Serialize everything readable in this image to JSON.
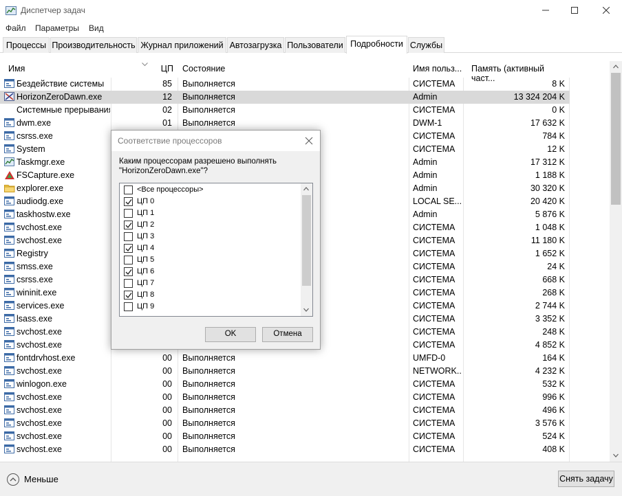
{
  "window": {
    "title": "Диспетчер задач"
  },
  "menu": [
    "Файл",
    "Параметры",
    "Вид"
  ],
  "tabs": [
    "Процессы",
    "Производительность",
    "Журнал приложений",
    "Автозагрузка",
    "Пользователи",
    "Подробности",
    "Службы"
  ],
  "active_tab": "Подробности",
  "table": {
    "columns": [
      "Имя",
      "ЦП",
      "Состояние",
      "Имя польз...",
      "Память (активный част..."
    ],
    "rows": [
      {
        "icon": "system-idle-icon",
        "name": "Бездействие системы",
        "cpu": "85",
        "state": "Выполняется",
        "user": "СИСТЕМА",
        "mem": "8 K"
      },
      {
        "icon": "game-icon",
        "name": "HorizonZeroDawn.exe",
        "cpu": "12",
        "state": "Выполняется",
        "user": "Admin",
        "mem": "13 324 204 K",
        "selected": true
      },
      {
        "icon": "none",
        "name": "Системные прерывания",
        "cpu": "02",
        "state": "Выполняется",
        "user": "СИСТЕМА",
        "mem": "0 K"
      },
      {
        "icon": "process-icon",
        "name": "dwm.exe",
        "cpu": "01",
        "state": "Выполняется",
        "user": "DWM-1",
        "mem": "17 632 K"
      },
      {
        "icon": "process-icon",
        "name": "csrss.exe",
        "cpu": "",
        "state": "",
        "user": "СИСТЕМА",
        "mem": "784 K"
      },
      {
        "icon": "process-icon",
        "name": "System",
        "cpu": "",
        "state": "",
        "user": "СИСТЕМА",
        "mem": "12 K"
      },
      {
        "icon": "taskmgr-icon",
        "name": "Taskmgr.exe",
        "cpu": "",
        "state": "",
        "user": "Admin",
        "mem": "17 312 K"
      },
      {
        "icon": "fscapture-icon",
        "name": "FSCapture.exe",
        "cpu": "",
        "state": "",
        "user": "Admin",
        "mem": "1 188 K"
      },
      {
        "icon": "explorer-icon",
        "name": "explorer.exe",
        "cpu": "",
        "state": "",
        "user": "Admin",
        "mem": "30 320 K"
      },
      {
        "icon": "process-icon",
        "name": "audiodg.exe",
        "cpu": "",
        "state": "",
        "user": "LOCAL SE...",
        "mem": "20 420 K"
      },
      {
        "icon": "process-icon",
        "name": "taskhostw.exe",
        "cpu": "",
        "state": "",
        "user": "Admin",
        "mem": "5 876 K"
      },
      {
        "icon": "process-icon",
        "name": "svchost.exe",
        "cpu": "",
        "state": "",
        "user": "СИСТЕМА",
        "mem": "1 048 K"
      },
      {
        "icon": "process-icon",
        "name": "svchost.exe",
        "cpu": "",
        "state": "",
        "user": "СИСТЕМА",
        "mem": "11 180 K"
      },
      {
        "icon": "process-icon",
        "name": "Registry",
        "cpu": "",
        "state": "",
        "user": "СИСТЕМА",
        "mem": "1 652 K"
      },
      {
        "icon": "process-icon",
        "name": "smss.exe",
        "cpu": "",
        "state": "",
        "user": "СИСТЕМА",
        "mem": "24 K"
      },
      {
        "icon": "process-icon",
        "name": "csrss.exe",
        "cpu": "",
        "state": "",
        "user": "СИСТЕМА",
        "mem": "668 K"
      },
      {
        "icon": "process-icon",
        "name": "wininit.exe",
        "cpu": "",
        "state": "",
        "user": "СИСТЕМА",
        "mem": "268 K"
      },
      {
        "icon": "process-icon",
        "name": "services.exe",
        "cpu": "",
        "state": "",
        "user": "СИСТЕМА",
        "mem": "2 744 K"
      },
      {
        "icon": "process-icon",
        "name": "lsass.exe",
        "cpu": "",
        "state": "",
        "user": "СИСТЕМА",
        "mem": "3 352 K"
      },
      {
        "icon": "process-icon",
        "name": "svchost.exe",
        "cpu": "",
        "state": "",
        "user": "СИСТЕМА",
        "mem": "248 K"
      },
      {
        "icon": "process-icon",
        "name": "svchost.exe",
        "cpu": "",
        "state": "",
        "user": "СИСТЕМА",
        "mem": "4 852 K"
      },
      {
        "icon": "process-icon",
        "name": "fontdrvhost.exe",
        "cpu": "00",
        "state": "Выполняется",
        "user": "UMFD-0",
        "mem": "164 K"
      },
      {
        "icon": "process-icon",
        "name": "svchost.exe",
        "cpu": "00",
        "state": "Выполняется",
        "user": "NETWORK...",
        "mem": "4 232 K"
      },
      {
        "icon": "process-icon",
        "name": "winlogon.exe",
        "cpu": "00",
        "state": "Выполняется",
        "user": "СИСТЕМА",
        "mem": "532 K"
      },
      {
        "icon": "process-icon",
        "name": "svchost.exe",
        "cpu": "00",
        "state": "Выполняется",
        "user": "СИСТЕМА",
        "mem": "996 K"
      },
      {
        "icon": "process-icon",
        "name": "svchost.exe",
        "cpu": "00",
        "state": "Выполняется",
        "user": "СИСТЕМА",
        "mem": "496 K"
      },
      {
        "icon": "process-icon",
        "name": "svchost.exe",
        "cpu": "00",
        "state": "Выполняется",
        "user": "СИСТЕМА",
        "mem": "3 576 K"
      },
      {
        "icon": "process-icon",
        "name": "svchost.exe",
        "cpu": "00",
        "state": "Выполняется",
        "user": "СИСТЕМА",
        "mem": "524 K"
      },
      {
        "icon": "process-icon",
        "name": "svchost.exe",
        "cpu": "00",
        "state": "Выполняется",
        "user": "СИСТЕМА",
        "mem": "408 K"
      }
    ]
  },
  "footer": {
    "less_label": "Меньше",
    "end_task_label": "Снять задачу"
  },
  "dialog": {
    "title": "Соответствие процессоров",
    "prompt_line1": "Каким процессорам разрешено выполнять",
    "prompt_line2": "\"HorizonZeroDawn.exe\"?",
    "items": [
      {
        "label": "<Все процессоры>",
        "checked": false
      },
      {
        "label": "ЦП 0",
        "checked": true
      },
      {
        "label": "ЦП 1",
        "checked": false
      },
      {
        "label": "ЦП 2",
        "checked": true
      },
      {
        "label": "ЦП 3",
        "checked": false
      },
      {
        "label": "ЦП 4",
        "checked": true
      },
      {
        "label": "ЦП 5",
        "checked": false
      },
      {
        "label": "ЦП 6",
        "checked": true
      },
      {
        "label": "ЦП 7",
        "checked": false
      },
      {
        "label": "ЦП 8",
        "checked": true
      },
      {
        "label": "ЦП 9",
        "checked": false
      }
    ],
    "ok_label": "OK",
    "cancel_label": "Отмена"
  },
  "colors": {
    "selected_row": "#d9d9d9",
    "accent": "#0078d7"
  }
}
